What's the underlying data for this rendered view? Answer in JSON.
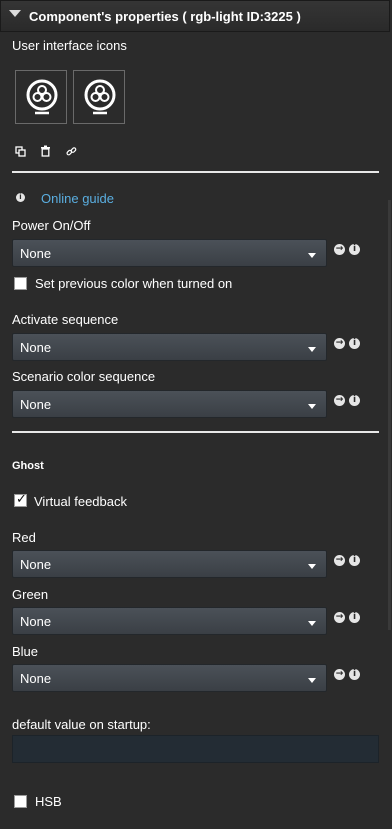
{
  "header": {
    "title": "Component's properties ( rgb-light ID:3225 )"
  },
  "ui_icons": {
    "label": "User interface icons"
  },
  "toolbar": {
    "icons": [
      "copy-icon",
      "delete-icon",
      "link-icon"
    ]
  },
  "guide": {
    "label": "Online guide"
  },
  "power": {
    "label": "Power On/Off",
    "value": "None",
    "checkbox_label": "Set previous color when turned on",
    "checkbox_checked": false
  },
  "activate_sequence": {
    "label": "Activate sequence",
    "value": "None"
  },
  "scenario_sequence": {
    "label": "Scenario color sequence",
    "value": "None"
  },
  "ghost": {
    "heading": "Ghost",
    "virtual_feedback_label": "Virtual feedback",
    "virtual_feedback_checked": true
  },
  "red": {
    "label": "Red",
    "value": "None"
  },
  "green": {
    "label": "Green",
    "value": "None"
  },
  "blue": {
    "label": "Blue",
    "value": "None"
  },
  "default_value": {
    "label": "default value on startup:",
    "value": ""
  },
  "hsb": {
    "label": "HSB",
    "checked": false
  },
  "glyphs": {
    "check": "✓",
    "info": "i",
    "arrow": "→"
  },
  "colors": {
    "accent_link": "#5aaee0",
    "background": "#2b2b2b",
    "select_bg": "#43494f"
  }
}
